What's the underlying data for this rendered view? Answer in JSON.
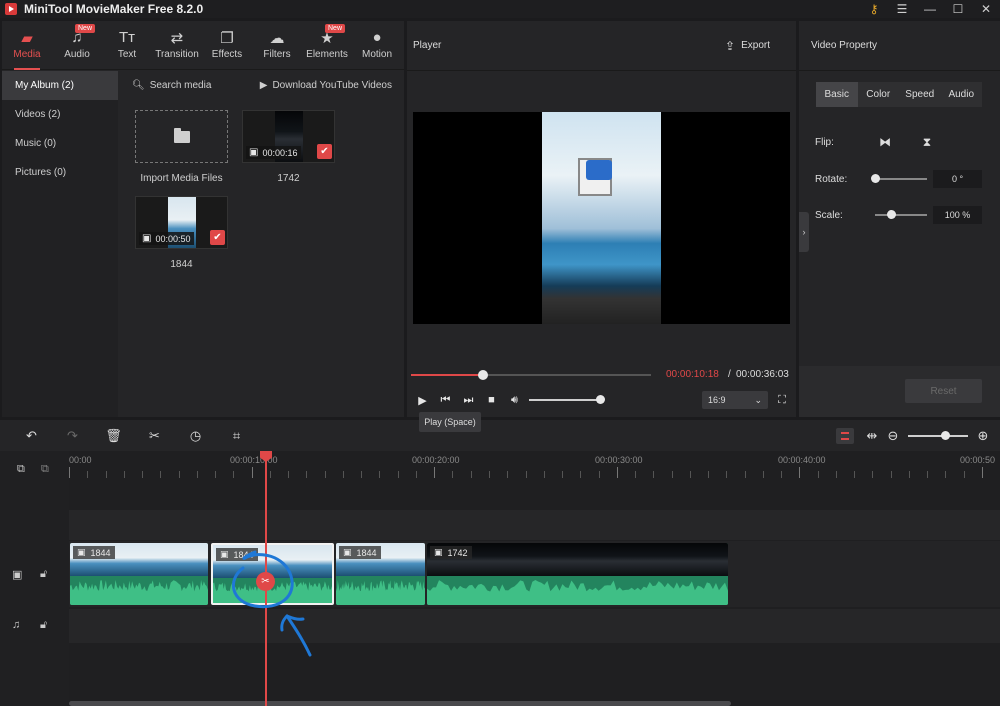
{
  "app": {
    "title": "MiniTool MovieMaker Free 8.2.0"
  },
  "media_tabs": [
    {
      "label": "Media",
      "icon": "folder-icon",
      "active": true,
      "badge": ""
    },
    {
      "label": "Audio",
      "icon": "music-icon",
      "active": false,
      "badge": "New"
    },
    {
      "label": "Text",
      "icon": "text-icon",
      "active": false,
      "badge": ""
    },
    {
      "label": "Transition",
      "icon": "transition-icon",
      "active": false,
      "badge": ""
    },
    {
      "label": "Effects",
      "icon": "effects-icon",
      "active": false,
      "badge": ""
    },
    {
      "label": "Filters",
      "icon": "filters-icon",
      "active": false,
      "badge": ""
    },
    {
      "label": "Elements",
      "icon": "elements-icon",
      "active": false,
      "badge": "New"
    },
    {
      "label": "Motion",
      "icon": "motion-icon",
      "active": false,
      "badge": ""
    }
  ],
  "albums": [
    {
      "label": "My Album (2)",
      "active": true
    },
    {
      "label": "Videos (2)",
      "active": false
    },
    {
      "label": "Music (0)",
      "active": false
    },
    {
      "label": "Pictures (0)",
      "active": false
    }
  ],
  "media_toolbar": {
    "search": "Search media",
    "download": "Download YouTube Videos"
  },
  "import": {
    "label": "Import Media Files"
  },
  "media_items": [
    {
      "name": "1742",
      "duration": "00:00:16"
    },
    {
      "name": "1844",
      "duration": "00:00:50"
    }
  ],
  "player": {
    "title": "Player",
    "export_label": "Export",
    "time_current": "00:00:10:18",
    "time_separator": "/",
    "time_total": "00:00:36:03",
    "progress": 0.2944,
    "volume": 1.0,
    "aspect": "16:9",
    "tooltip": "Play (Space)"
  },
  "properties": {
    "title": "Video Property",
    "tabs": [
      "Basic",
      "Color",
      "Speed",
      "Audio"
    ],
    "active_tab": "Basic",
    "flip_label": "Flip:",
    "rotate_label": "Rotate:",
    "rotate_value": "0 °",
    "rotate_level": 0.0,
    "scale_label": "Scale:",
    "scale_value": "100 %",
    "scale_level": 0.3,
    "reset_label": "Reset"
  },
  "timeline": {
    "ruler_labels": [
      "00:00",
      "00:00:10:00",
      "00:00:20:00",
      "00:00:30:00",
      "00:00:40:00",
      "00:00:50"
    ],
    "clips": [
      {
        "name": "1844",
        "kind": "day"
      },
      {
        "name": "1844",
        "kind": "day",
        "selected": true
      },
      {
        "name": "1844",
        "kind": "day"
      },
      {
        "name": "1742",
        "kind": "night"
      }
    ]
  },
  "colors": {
    "accent": "#e04848",
    "waveform": "#23845e",
    "annotation": "#1f78d6"
  }
}
